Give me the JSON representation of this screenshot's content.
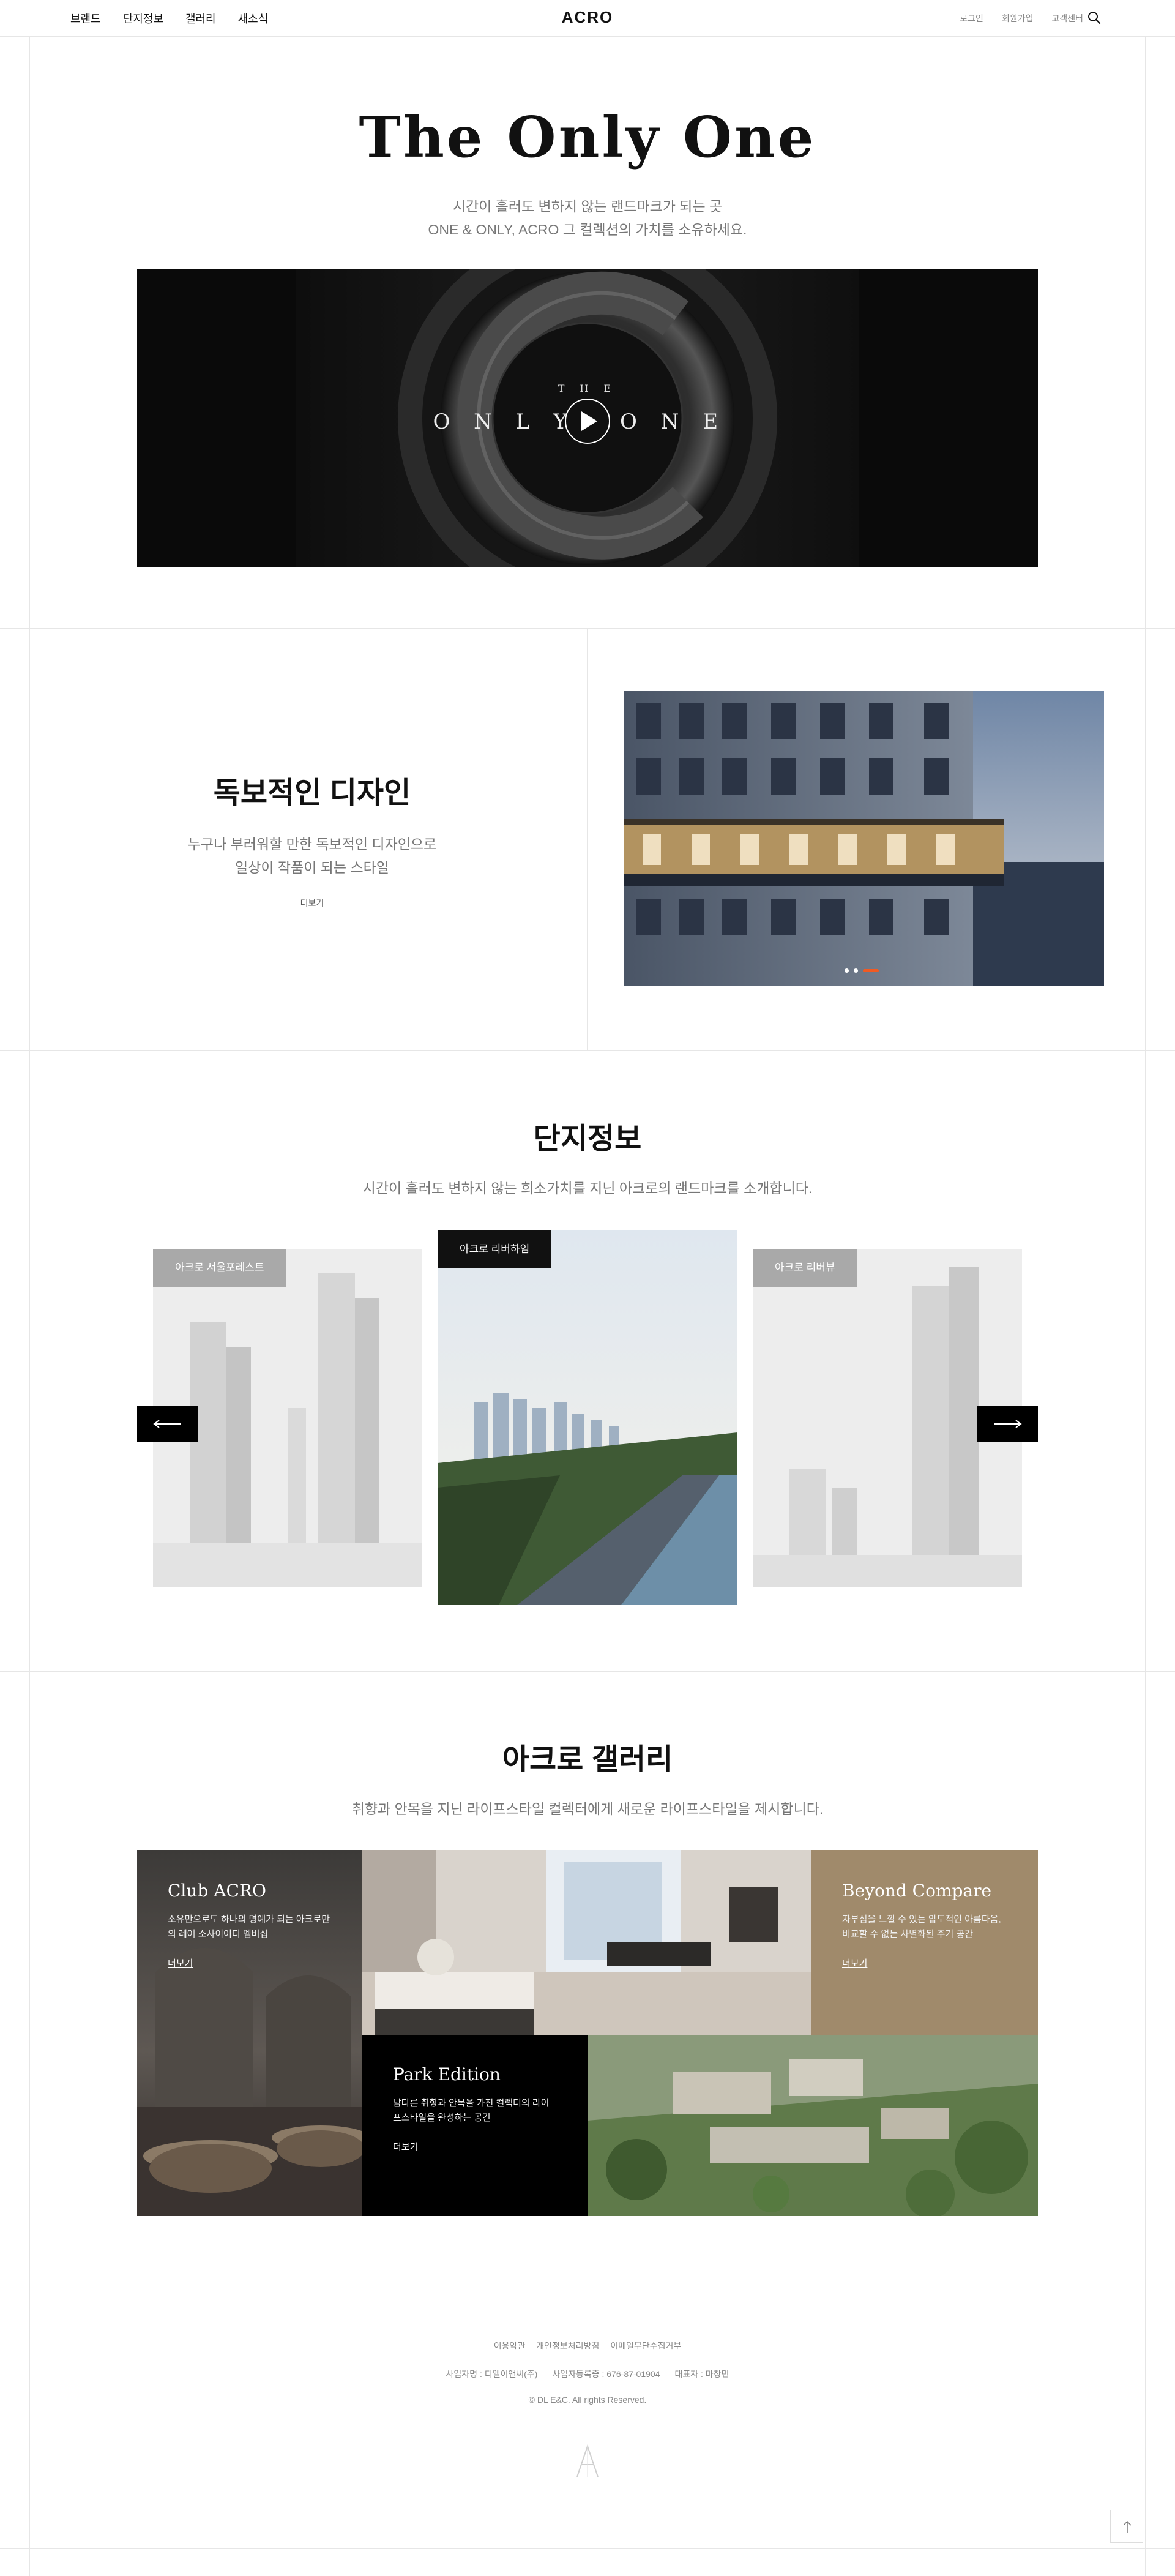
{
  "header": {
    "nav_left": [
      "브랜드",
      "단지정보",
      "갤러리",
      "새소식"
    ],
    "logo": "ACRO",
    "nav_right": [
      "로그인",
      "회원가입",
      "고객센터"
    ]
  },
  "hero": {
    "title": "The Only One",
    "subtitle_line1": "시간이 흘러도 변하지 않는 랜드마크가 되는 곳",
    "subtitle_line2": "ONE & ONLY, ACRO 그 컬렉션의 가치를 소유하세요.",
    "video_text_top": "T H E",
    "video_text_left": "O N L Y",
    "video_text_right": "O N E"
  },
  "design": {
    "title": "독보적인 디자인",
    "line1": "누구나 부러워할 만한 독보적인 디자인으로",
    "line2": "일상이 작품이 되는 스타일",
    "more": "더보기",
    "slide_count": 3,
    "active_slide": 3,
    "accent": "#f15a22"
  },
  "complex": {
    "title": "단지정보",
    "subtitle": "시간이 흘러도 변하지 않는 희소가치를 지닌 아크로의 랜드마크를 소개합니다.",
    "cards": [
      {
        "label": "아크로 서울포레스트"
      },
      {
        "label": "아크로 리버하임"
      },
      {
        "label": "아크로 리버뷰"
      }
    ]
  },
  "gallery": {
    "title": "아크로 갤러리",
    "subtitle": "취향과 안목을 지닌 라이프스타일 컬렉터에게 새로운 라이프스타일을 제시합니다.",
    "club": {
      "title": "Club ACRO",
      "desc1": "소유만으로도 하나의 명예가 되는 아크로만",
      "desc2": "의 레어 소사이어티 멤버십",
      "more": "더보기"
    },
    "beyond": {
      "title": "Beyond Compare",
      "desc1": "자부심을 느낄 수 있는 압도적인 아름다움,",
      "desc2": "비교할 수 없는 차별화된 주거 공간",
      "more": "더보기",
      "color": "#a08a6b"
    },
    "park": {
      "title": "Park Edition",
      "desc1": "남다른 취향과 안목을 가진 컬렉터의 라이",
      "desc2": "프스타일을 완성하는 공간",
      "more": "더보기"
    }
  },
  "footer": {
    "links": [
      "이용약관",
      "개인정보처리방침",
      "이메일무단수집거부"
    ],
    "company": "사업자명 : 디엘이앤씨(주)",
    "reg": "사업자등록증 : 676-87-01904",
    "ceo": "대표자 : 마창민",
    "copyright": "© DL E&C. All rights Reserved."
  }
}
